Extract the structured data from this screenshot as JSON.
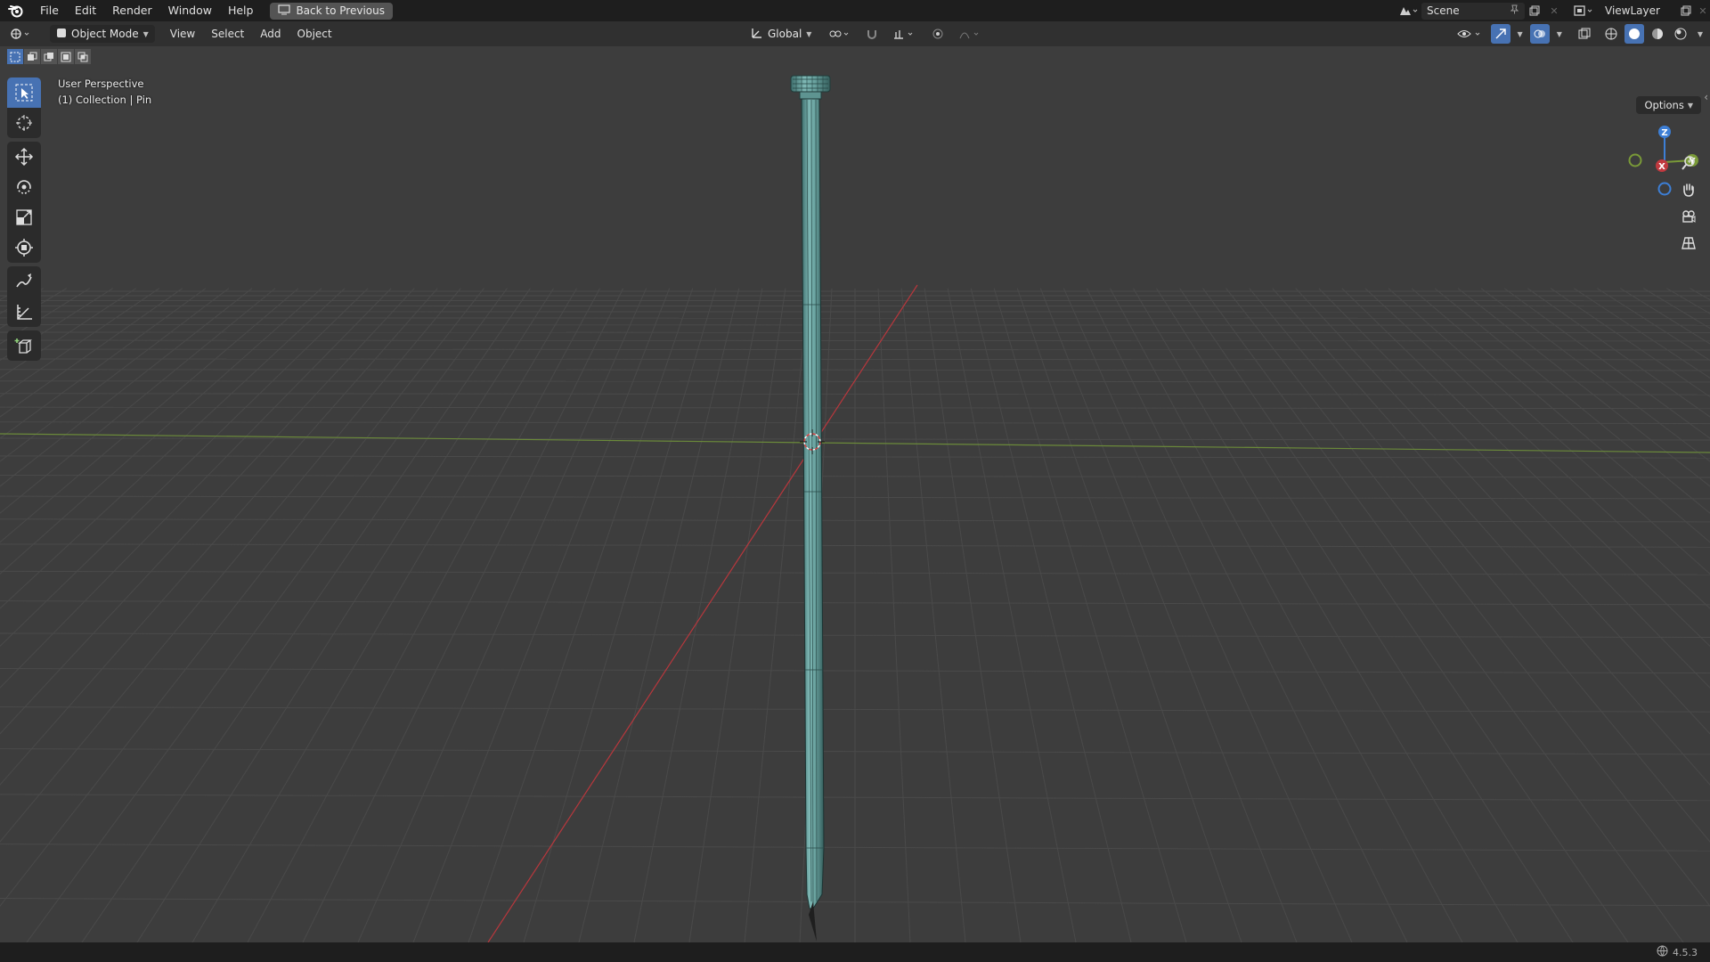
{
  "menu": {
    "items": [
      "File",
      "Edit",
      "Render",
      "Window",
      "Help"
    ],
    "back_button": "Back to Previous"
  },
  "scene": {
    "name": "Scene"
  },
  "view_layer": {
    "name": "ViewLayer"
  },
  "header": {
    "mode": "Object Mode",
    "menus": [
      "View",
      "Select",
      "Add",
      "Object"
    ],
    "orientation": "Global"
  },
  "viewport": {
    "perspective_label": "User Perspective",
    "object_label": "(1) Collection | Pin",
    "options_label": "Options"
  },
  "gizmo": {
    "z_label": "Z",
    "y_label": "Y",
    "x_label": "X"
  },
  "status": {
    "version": "4.5.3"
  },
  "colors": {
    "accent": "#4772b3",
    "mesh": "#6fa8a6",
    "x_axis": "#c0393f",
    "y_axis": "#7a9a38",
    "z_axis": "#3d7fd6"
  }
}
